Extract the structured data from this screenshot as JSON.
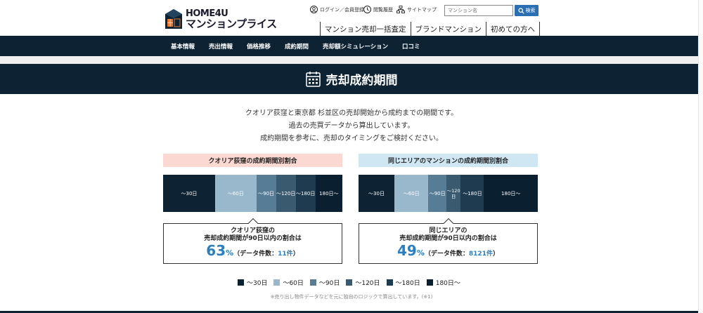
{
  "header": {
    "logo_top": "HOME4U",
    "logo_bottom": "マンションプライス",
    "util_login": "ログイン／会員登録",
    "util_history": "閲覧履歴",
    "util_sitemap": "サイトマップ",
    "search_placeholder": "マンション名",
    "search_button": "検索",
    "mega_links": [
      "マンション売却一括査定",
      "ブランドマンション",
      "初めての方へ"
    ]
  },
  "nav": [
    "基本情報",
    "売出情報",
    "価格推移",
    "成約期間",
    "売却額シミュレーション",
    "口コミ"
  ],
  "section": {
    "title": "売却成約期間"
  },
  "description": [
    "クオリア荻窪と東京都 杉並区の売却開始から成約までの期間です。",
    "過去の売買データから算出しています。",
    "成約期間を参考に、売却のタイミングをご検討ください。"
  ],
  "colors": {
    "d30": "#0d2232",
    "d60": "#9ab8cc",
    "d90": "#577c96",
    "d120": "#3a5a70",
    "d180": "#1f3b50",
    "d180plus": "#0a1f30",
    "accent": "#2a7fc0",
    "pink": "#fbd9d2",
    "lightblue": "#cfe6f3"
  },
  "chart_data": [
    {
      "type": "bar",
      "title": "クオリア荻窪の成約期間別割合",
      "categories": [
        "〜30日",
        "〜60日",
        "〜90日",
        "〜120日",
        "〜180日",
        "180日〜"
      ],
      "values": [
        29,
        23,
        11,
        11,
        11,
        15
      ],
      "callout": {
        "line1": "クオリア荻窪の",
        "line2": "売却成約期間が90日以内の割合は",
        "percent": "63",
        "percent_unit": "%",
        "count_prefix": "（データ件数：",
        "count": "11件",
        "count_suffix": "）"
      }
    },
    {
      "type": "bar",
      "title": "同じエリアのマンションの成約期間別割合",
      "categories": [
        "〜30日",
        "〜60日",
        "〜90日",
        "〜120日",
        "〜180日",
        "180日〜"
      ],
      "values": [
        20,
        19,
        10,
        8,
        13,
        30
      ],
      "callout": {
        "line1": "同じエリアの",
        "line2": "売却成約期間が90日以内の割合は",
        "percent": "49",
        "percent_unit": "%",
        "count_prefix": "（データ件数：",
        "count": "8121件",
        "count_suffix": "）"
      }
    }
  ],
  "legend": [
    "〜30日",
    "〜60日",
    "〜90日",
    "〜120日",
    "〜180日",
    "180日〜"
  ],
  "note": "※売り出し物件データなどを元に独自のロジックで算出しています。(※1)"
}
